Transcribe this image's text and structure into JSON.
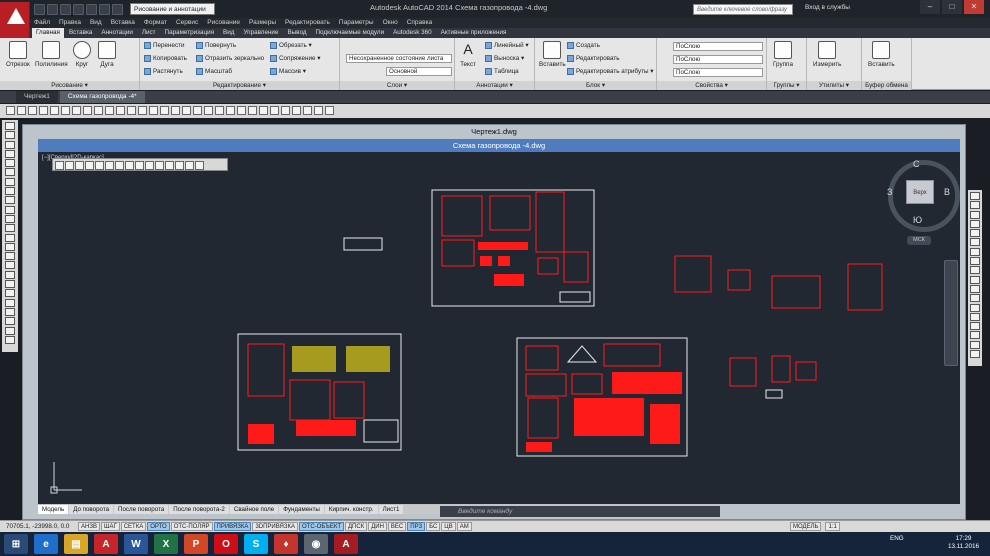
{
  "app": {
    "title": "Autodesk AutoCAD 2014      Схема газопровода -4.dwg",
    "workspace": "Рисование и аннотации",
    "search_placeholder": "Введите ключевое слово/фразу",
    "login_label": "Вход в службы",
    "window_controls": [
      "–",
      "□",
      "✕"
    ]
  },
  "menubar": [
    "Файл",
    "Правка",
    "Вид",
    "Вставка",
    "Формат",
    "Сервис",
    "Рисование",
    "Размеры",
    "Редактировать",
    "Параметры",
    "Окно",
    "Справка"
  ],
  "ribbon_tabs": [
    "Главная",
    "Вставка",
    "Аннотации",
    "Лист",
    "Параметризация",
    "Вид",
    "Управление",
    "Вывод",
    "Подключаемые модули",
    "Autodesk 360",
    "Активные приложения"
  ],
  "active_ribbon_tab": "Главная",
  "ribbon": {
    "draw": {
      "title": "Рисование ▾",
      "tools": [
        "Отрезок",
        "Полилиния",
        "Круг",
        "Дуга"
      ]
    },
    "modify": {
      "title": "Редактирование ▾",
      "col1": [
        "Перенести",
        "Копировать",
        "Растянуть"
      ],
      "col2": [
        "Повернуть",
        "Отразить зеркально",
        "Масштаб"
      ],
      "col3": [
        "Обрезать ▾",
        "Сопряжение ▾",
        "Массив ▾"
      ]
    },
    "layers": {
      "title": "Слои ▾",
      "state": "Несохраненное состояние листа",
      "current": "Основной"
    },
    "annotation": {
      "title": "Аннотации ▾",
      "big": "Текст",
      "items": [
        "Линейный ▾",
        "Выноска ▾",
        "Таблица"
      ]
    },
    "block": {
      "title": "Блок ▾",
      "big": "Вставить",
      "items": [
        "Создать",
        "Редактировать",
        "Редактировать атрибуты ▾"
      ]
    },
    "properties": {
      "title": "Свойства ▾",
      "combo1": "ПоСлою",
      "combo2": "ПоСлою",
      "combo3": "ПоСлою"
    },
    "groups": {
      "title": "Группы ▾",
      "big": "Группа"
    },
    "utilities": {
      "title": "Утилиты ▾",
      "big": "Измерить"
    },
    "clipboard": {
      "title": "Буфер обмена",
      "big": "Вставить"
    }
  },
  "doc_tabs": [
    "Чертеж1",
    "Схема газопровода -4*"
  ],
  "active_doc_tab": "Схема газопровода -4*",
  "outer_window_title": "Чертеж1.dwg",
  "inner_window_title": "Схема газопровода -4.dwg",
  "viewport_label": "[−][Сверху][2D-каркас]",
  "viewcube": {
    "face": "Верх",
    "north": "С",
    "south": "Ю",
    "west": "З",
    "east": "В",
    "wcs": "МСК"
  },
  "layout_tabs": [
    "Модель",
    "До поворота",
    "После поворота",
    "После поворота-2",
    "Свайное поле",
    "Фундаменты",
    "Кирпич. констр.",
    "Лист1"
  ],
  "active_layout_tab": "Модель",
  "command_placeholder": "Введите команду",
  "status": {
    "coords": "70705.1, -23998.0, 0.0",
    "toggles": [
      {
        "label": "АНЗВ",
        "on": false
      },
      {
        "label": "ШАГ",
        "on": false
      },
      {
        "label": "СЕТКА",
        "on": false
      },
      {
        "label": "ОРТО",
        "on": true
      },
      {
        "label": "ОТС-ПОЛЯР",
        "on": false
      },
      {
        "label": "ПРИВЯЗКА",
        "on": true
      },
      {
        "label": "3DПРИВЯЗКА",
        "on": false
      },
      {
        "label": "ОТС-ОБЪЕКТ",
        "on": true
      },
      {
        "label": "ДПСК",
        "on": false
      },
      {
        "label": "ДИН",
        "on": false
      },
      {
        "label": "ВЕС",
        "on": false
      },
      {
        "label": "ПРЗ",
        "on": true
      },
      {
        "label": "БС",
        "on": false
      },
      {
        "label": "ЦВ",
        "on": false
      },
      {
        "label": "АМ",
        "on": false
      }
    ],
    "model_label": "МОДЕЛЬ",
    "scale": "1:1"
  },
  "taskbar": {
    "apps": [
      {
        "name": "ie",
        "label": "e",
        "color": "#1e6fc9"
      },
      {
        "name": "explorer",
        "label": "▤",
        "color": "#d9a62a"
      },
      {
        "name": "autocad",
        "label": "A",
        "color": "#c6262a"
      },
      {
        "name": "word",
        "label": "W",
        "color": "#2b579a"
      },
      {
        "name": "excel",
        "label": "X",
        "color": "#217346"
      },
      {
        "name": "powerpoint",
        "label": "P",
        "color": "#d24726"
      },
      {
        "name": "opera",
        "label": "O",
        "color": "#cc0f16"
      },
      {
        "name": "skype",
        "label": "S",
        "color": "#00aff0"
      },
      {
        "name": "pdf",
        "label": "♦",
        "color": "#c5352b"
      },
      {
        "name": "chrome",
        "label": "◉",
        "color": "#5c6670"
      },
      {
        "name": "autocad2",
        "label": "A",
        "color": "#a31d22"
      }
    ],
    "lang": "ENG",
    "time": "17:29",
    "date": "13.11.2016"
  },
  "colors": {
    "drawing_red": "#ff1a1a",
    "sheet_frame": "#e8e8e8",
    "canvas_bg": "#222831"
  }
}
